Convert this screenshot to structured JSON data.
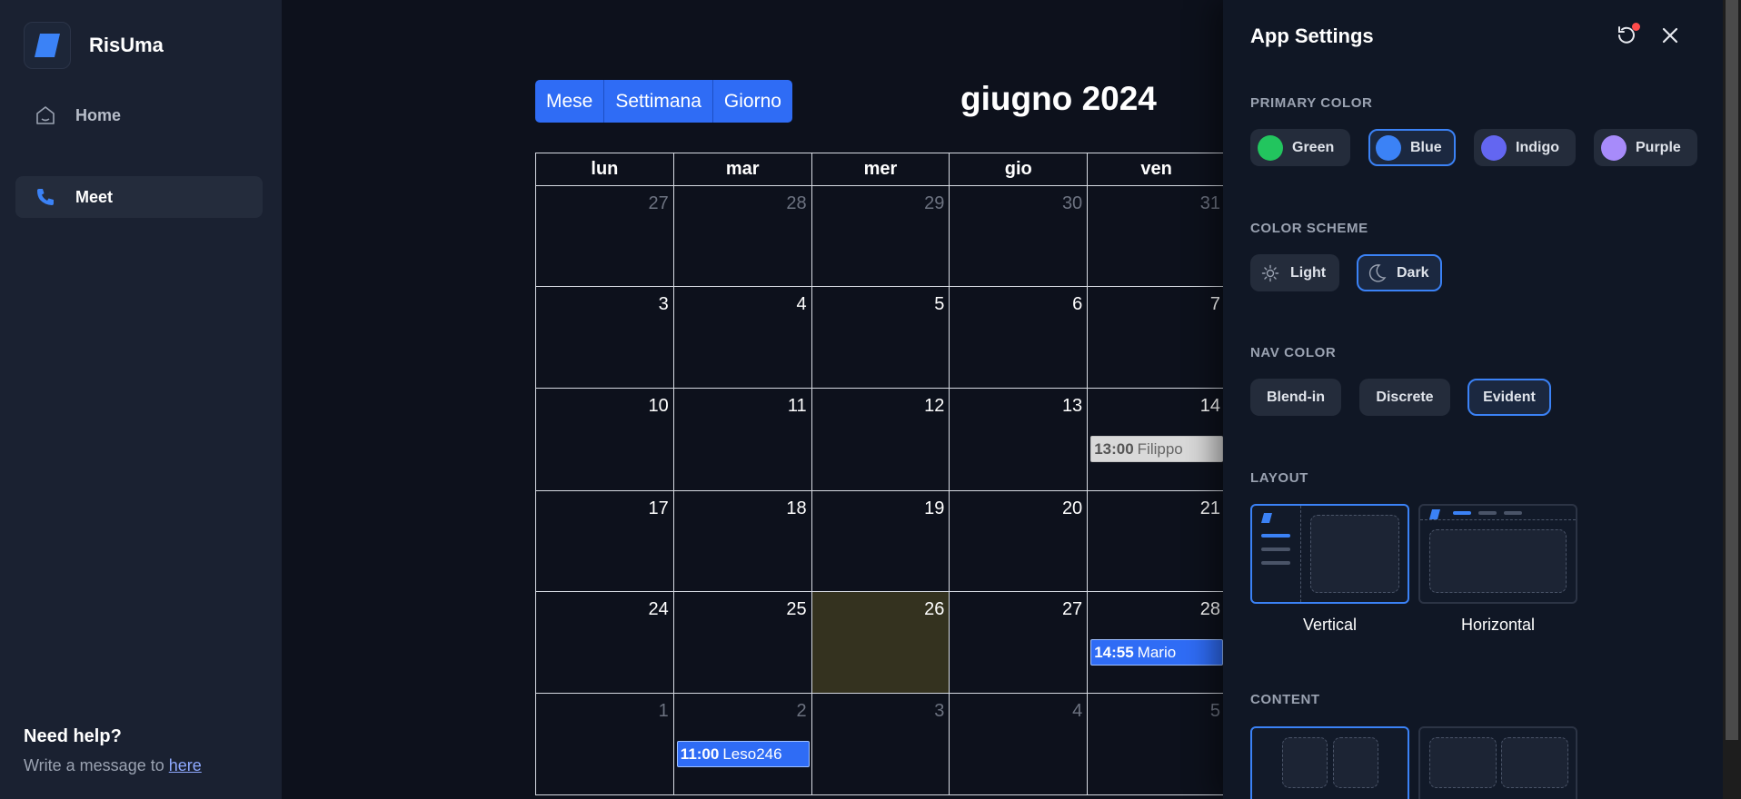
{
  "sidebar": {
    "brand": "RisUma",
    "nav": [
      {
        "label": "Home",
        "icon": "home-icon"
      },
      {
        "label": "Meet",
        "icon": "phone-icon",
        "active": true
      }
    ],
    "help": {
      "title": "Need help?",
      "text": "Write a message to",
      "link": "here"
    }
  },
  "calendar": {
    "views": [
      "Mese",
      "Settimana",
      "Giorno"
    ],
    "title": "giugno 2024",
    "weekdays": [
      "lun",
      "mar",
      "mer",
      "gio",
      "ven"
    ],
    "weeks": [
      [
        {
          "day": "27",
          "muted": true
        },
        {
          "day": "28",
          "muted": true
        },
        {
          "day": "29",
          "muted": true
        },
        {
          "day": "30",
          "muted": true
        },
        {
          "day": "31",
          "muted": true
        }
      ],
      [
        {
          "day": "3"
        },
        {
          "day": "4"
        },
        {
          "day": "5"
        },
        {
          "day": "6"
        },
        {
          "day": "7"
        }
      ],
      [
        {
          "day": "10"
        },
        {
          "day": "11"
        },
        {
          "day": "12"
        },
        {
          "day": "13"
        },
        {
          "day": "14",
          "event": {
            "time": "13:00",
            "title": "Filippo",
            "style": "grey"
          }
        }
      ],
      [
        {
          "day": "17"
        },
        {
          "day": "18"
        },
        {
          "day": "19"
        },
        {
          "day": "20"
        },
        {
          "day": "21"
        }
      ],
      [
        {
          "day": "24"
        },
        {
          "day": "25"
        },
        {
          "day": "26",
          "today": true
        },
        {
          "day": "27"
        },
        {
          "day": "28",
          "event": {
            "time": "14:55",
            "title": "Mario",
            "style": "blue"
          }
        }
      ],
      [
        {
          "day": "1",
          "muted": true
        },
        {
          "day": "2",
          "muted": true,
          "event": {
            "time": "11:00",
            "title": "Leso246",
            "style": "blue"
          }
        },
        {
          "day": "3",
          "muted": true
        },
        {
          "day": "4",
          "muted": true
        },
        {
          "day": "5",
          "muted": true
        }
      ]
    ]
  },
  "settings": {
    "title": "App Settings",
    "reset_icon": "reset-icon",
    "close_icon": "close-icon",
    "primary_color": {
      "title": "PRIMARY COLOR",
      "options": [
        {
          "label": "Green",
          "color": "#22c55e"
        },
        {
          "label": "Blue",
          "color": "#3b82f6",
          "selected": true
        },
        {
          "label": "Indigo",
          "color": "#6366f1"
        },
        {
          "label": "Purple",
          "color": "#a78bfa"
        }
      ]
    },
    "color_scheme": {
      "title": "COLOR SCHEME",
      "options": [
        {
          "label": "Light",
          "icon": "sun-icon"
        },
        {
          "label": "Dark",
          "icon": "moon-icon",
          "selected": true
        }
      ]
    },
    "nav_color": {
      "title": "NAV COLOR",
      "options": [
        {
          "label": "Blend-in"
        },
        {
          "label": "Discrete"
        },
        {
          "label": "Evident",
          "selected": true
        }
      ]
    },
    "layout": {
      "title": "LAYOUT",
      "options": [
        {
          "label": "Vertical",
          "selected": true
        },
        {
          "label": "Horizontal"
        }
      ]
    },
    "content": {
      "title": "CONTENT"
    }
  },
  "colors": {
    "accent": "#3b82f6",
    "button_blue": "#2f6cf5",
    "today_bg": "#34321f",
    "sidebar_bg": "#1a2131",
    "drawer_bg": "#101725"
  }
}
